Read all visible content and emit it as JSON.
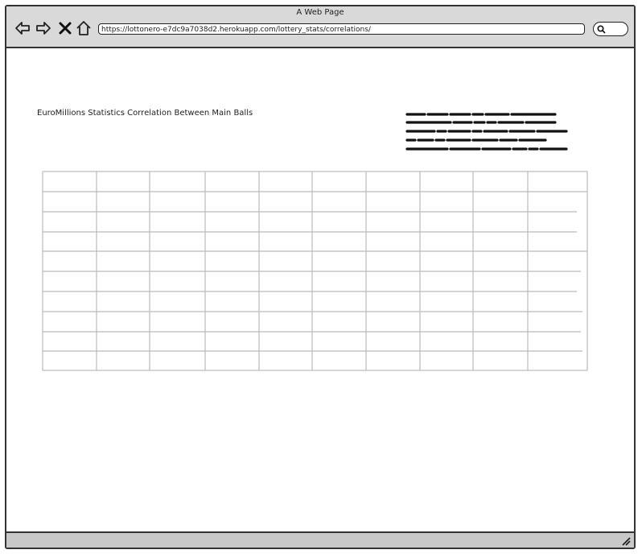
{
  "window": {
    "title": "A Web Page"
  },
  "nav": {
    "back_icon": "back-arrow-icon",
    "forward_icon": "forward-arrow-icon",
    "stop_icon": "close-icon",
    "home_icon": "home-icon"
  },
  "address_bar": {
    "url": "https://lottonero-e7dc9a7038d2.herokuapp.com/lottery_stats/correlations/"
  },
  "search": {
    "icon": "search-icon"
  },
  "page": {
    "title": "EuroMillions Statistics Correlation Between Main Balls"
  },
  "table": {
    "rows": 10,
    "columns": 10
  },
  "colors": {
    "titlebar": "#d9d9d9",
    "statusbar": "#c8c8c8",
    "outline": "#333333",
    "grid": "#bbbbbb",
    "scribble": "#111111"
  }
}
